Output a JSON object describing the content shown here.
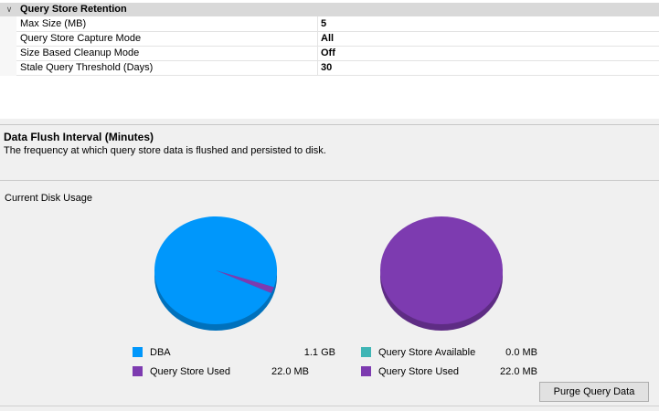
{
  "property_grid": {
    "category": "Query Store Retention",
    "toggle_icon": "chevron-down-icon",
    "properties": [
      {
        "name": "Max Size (MB)",
        "value": "5"
      },
      {
        "name": "Query Store Capture Mode",
        "value": "All"
      },
      {
        "name": "Size Based Cleanup Mode",
        "value": "Off"
      },
      {
        "name": "Stale Query Threshold (Days)",
        "value": "30"
      }
    ]
  },
  "description": {
    "title": "Data Flush Interval (Minutes)",
    "text": "The frequency at which query store data is flushed and persisted to disk."
  },
  "disk_usage": {
    "label": "Current Disk Usage"
  },
  "colors": {
    "dba": "#0097fb",
    "query_store_used": "#7d3bb0",
    "query_store_available": "#3fb5b5"
  },
  "chart_data": [
    {
      "type": "pie",
      "legend": [
        {
          "name": "DBA",
          "value": "1.1 GB"
        },
        {
          "name": "Query Store Used",
          "value": "22.0 MB"
        }
      ],
      "values_mb": [
        1126.4,
        22.0
      ]
    },
    {
      "type": "pie",
      "legend": [
        {
          "name": "Query Store Available",
          "value": "0.0 MB"
        },
        {
          "name": "Query Store Used",
          "value": "22.0 MB"
        }
      ],
      "values_mb": [
        0.0,
        22.0
      ]
    }
  ],
  "buttons": {
    "purge": "Purge Query Data"
  }
}
